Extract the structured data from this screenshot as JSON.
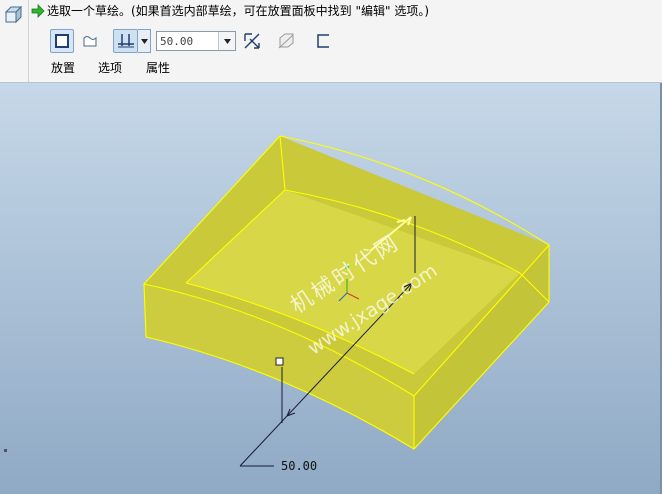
{
  "message": {
    "arrow_icon": "green-right-arrow-icon",
    "text": "选取一个草绘。(如果首选内部草绘，可在放置面板中找到 \"编辑\" 选项。)"
  },
  "toolbar": {
    "solid_icon": "solid-extrude-icon",
    "surface_icon": "surface-extrude-icon",
    "depth_option_icon": "blind-depth-icon",
    "depth_value": "50.00",
    "flip_icon": "flip-direction-icon",
    "remove_material_icon": "remove-material-icon",
    "thicken_icon": "thicken-sketch-icon"
  },
  "tabs": [
    {
      "label": "放置"
    },
    {
      "label": "选项"
    },
    {
      "label": "属性"
    }
  ],
  "viewport": {
    "dimension_label": "50.00",
    "watermark_cn": "机械时代网",
    "watermark_url": "www.jxage.com"
  },
  "colors": {
    "model_fill": "#d6d640",
    "model_edge": "#ffff00",
    "background_top": "#c6d8e8",
    "background_bottom": "#8fa9c5"
  }
}
